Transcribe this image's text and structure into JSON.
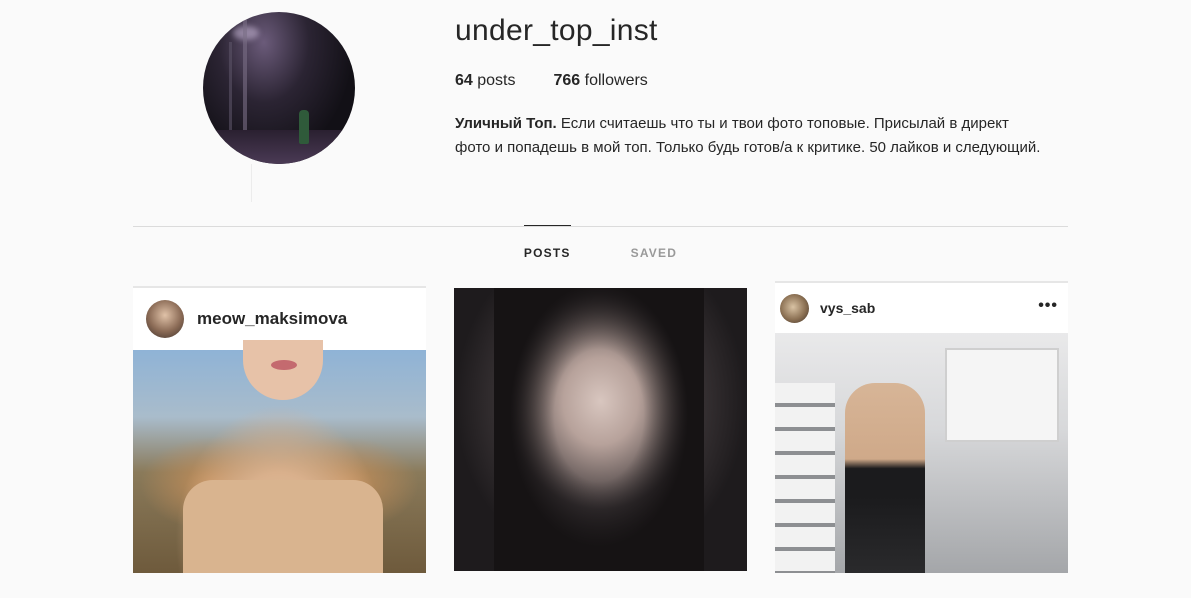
{
  "profile": {
    "username": "under_top_inst",
    "posts_count": "64",
    "posts_label": "posts",
    "followers_count": "766",
    "followers_label": "followers",
    "bio_name": "Уличный Топ.",
    "bio_text": "Если считаешь что ты и твои фото топовые. Присылай в директ фото и попадешь в мой топ. Только будь готов/а к критике. 50 лайков и следующий."
  },
  "tabs": [
    {
      "label": "POSTS",
      "active": true
    },
    {
      "label": "SAVED",
      "active": false
    }
  ],
  "posts": [
    {
      "username": "meow_maksimova"
    },
    {
      "username": ""
    },
    {
      "username": "vys_sab",
      "more": "•••"
    }
  ]
}
